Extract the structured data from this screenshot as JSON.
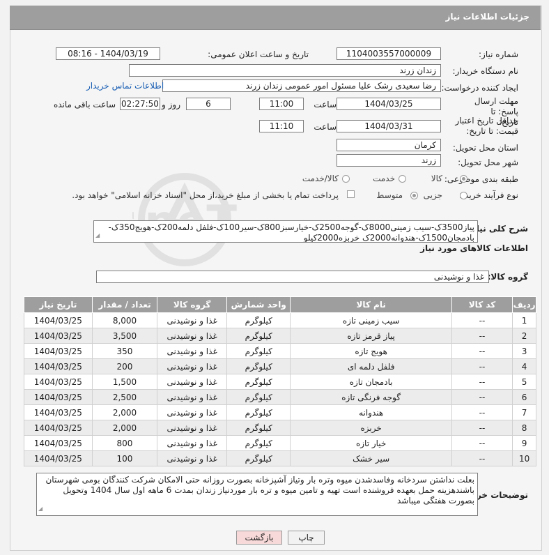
{
  "header": {
    "title": "جزئیات اطلاعات نیاز"
  },
  "labels": {
    "need_number": "شماره نیاز:",
    "announce_datetime": "تاریخ و ساعت اعلان عمومی:",
    "buyer_org": "نام دستگاه خریدار:",
    "requester": "ایجاد کننده درخواست:",
    "reply_deadline": "مهلت ارسال پاسخ: تا تاریخ:",
    "price_validity": "حداقل تاریخ اعتبار قیمت: تا تاریخ:",
    "time": "ساعت",
    "time2": "ساعت",
    "days_and": "روز و",
    "remaining": "ساعت باقی مانده",
    "province": "استان محل تحویل:",
    "city": "شهر محل تحویل:",
    "category": "طبقه بندی موضوعی:",
    "process_type": "نوع فرآیند خرید :",
    "description": "شرح کلی نیاز:",
    "goods_info": "اطلاعات کالاهای مورد نیاز",
    "goods_group": "گروه کالا:",
    "buyer_notes": "توضیحات خریدار:"
  },
  "fields": {
    "need_number": "1104003557000009",
    "announce_datetime": "1404/03/19 - 08:16",
    "buyer_org": "زندان زرند",
    "requester": "رضا سعیدی رشک علیا مسئول امور عمومی زندان زرند",
    "contact_link": "اطلاعات تماس خریدار",
    "reply_date": "1404/03/25",
    "reply_time": "11:00",
    "reply_days": "6",
    "reply_remaining": "02:27:50",
    "validity_date": "1404/03/31",
    "validity_time": "11:10",
    "province": "کرمان",
    "city": "زرند"
  },
  "category_options": {
    "goods": "کالا",
    "service": "خدمت",
    "goods_service": "کالا/خدمت",
    "selected": "goods"
  },
  "process_options": {
    "partial": "جزیی",
    "medium": "متوسط",
    "selected": "medium"
  },
  "payment_note": "پرداخت تمام یا بخشی از مبلغ خرید،از محل \"اسناد خزانه اسلامی\" خواهد بود.",
  "description_text": "پیاز3500ک-سیب زمینی8000ک-گوجه2500ک-خیارسبز800ک-سیر100ک-فلفل دلمه200ک-هویج350ک-بادمجان1500ک-هندوانه2000ک خربزه2000کیلو",
  "goods_group_value": "غذا و نوشیدنی",
  "table": {
    "headers": [
      "ردیف",
      "کد کالا",
      "نام کالا",
      "واحد شمارش",
      "گروه کالا",
      "تعداد / مقدار",
      "تاریخ نیاز"
    ],
    "rows": [
      [
        "1",
        "--",
        "سیب زمینی تازه",
        "کیلوگرم",
        "غذا و نوشیدنی",
        "8,000",
        "1404/03/25"
      ],
      [
        "2",
        "--",
        "پیاز قرمز تازه",
        "کیلوگرم",
        "غذا و نوشیدنی",
        "3,500",
        "1404/03/25"
      ],
      [
        "3",
        "--",
        "هویج تازه",
        "کیلوگرم",
        "غذا و نوشیدنی",
        "350",
        "1404/03/25"
      ],
      [
        "4",
        "--",
        "فلفل دلمه ای",
        "کیلوگرم",
        "غذا و نوشیدنی",
        "200",
        "1404/03/25"
      ],
      [
        "5",
        "--",
        "بادمجان تازه",
        "کیلوگرم",
        "غذا و نوشیدنی",
        "1,500",
        "1404/03/25"
      ],
      [
        "6",
        "--",
        "گوجه فرنگی تازه",
        "کیلوگرم",
        "غذا و نوشیدنی",
        "2,500",
        "1404/03/25"
      ],
      [
        "7",
        "--",
        "هندوانه",
        "کیلوگرم",
        "غذا و نوشیدنی",
        "2,000",
        "1404/03/25"
      ],
      [
        "8",
        "--",
        "خربزه",
        "کیلوگرم",
        "غذا و نوشیدنی",
        "2,000",
        "1404/03/25"
      ],
      [
        "9",
        "--",
        "خیار تازه",
        "کیلوگرم",
        "غذا و نوشیدنی",
        "800",
        "1404/03/25"
      ],
      [
        "10",
        "--",
        "سیر خشک",
        "کیلوگرم",
        "غذا و نوشیدنی",
        "100",
        "1404/03/25"
      ]
    ]
  },
  "buyer_notes_text": "بعلت نداشتن سردخانه وفاسدشدن میوه وتره بار وتیاز آشپزخانه  بصورت روزانه حتی الامکان شرکت کنندگان بومی شهرستان باشندهزینه حمل بعهده فروشنده  است تهیه و تامین میوه و تره بار موردنیاز زندان بمدت 6 ماهه اول سال 1404 وتحویل بصورت هفتگی میباشد",
  "buttons": {
    "print": "چاپ",
    "back": "بازگشت"
  },
  "watermark_text": "AriaTender.neT",
  "colors": {
    "header_bg": "#9e9e9e",
    "link": "#1a5fb4",
    "back_button_bg": "#f7d9d9"
  }
}
